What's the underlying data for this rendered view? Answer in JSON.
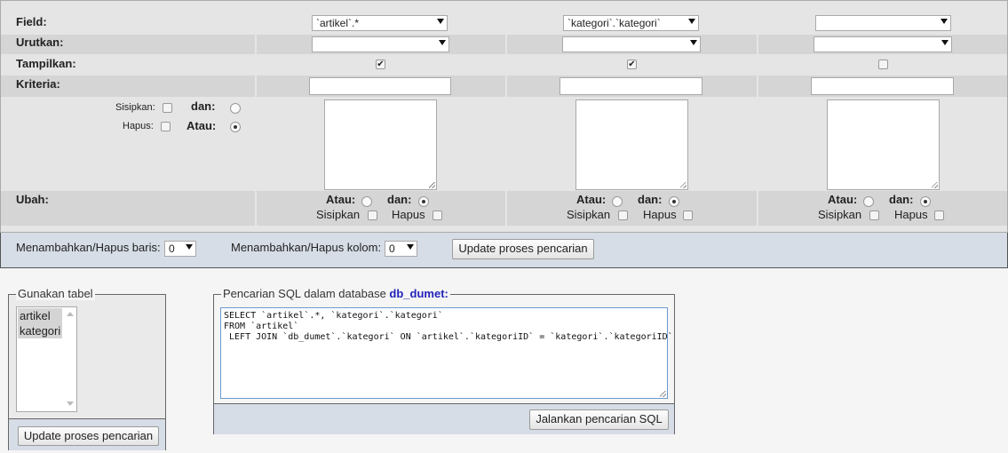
{
  "grid": {
    "labels": {
      "field": "Field:",
      "sort": "Urutkan:",
      "show": "Tampilkan:",
      "criteria": "Kriteria:",
      "change": "Ubah:"
    },
    "columns": [
      {
        "field": "`artikel`.*",
        "sort": "",
        "show": true
      },
      {
        "field": "`kategori`.`kategori`",
        "sort": "",
        "show": true
      },
      {
        "field": "",
        "sort": "",
        "show": false
      }
    ],
    "row_ops": {
      "insert_label": "Sisipkan:",
      "delete_label": "Hapus:",
      "and_label": "dan:",
      "or_label": "Atau:"
    },
    "col_ops": {
      "or_label": "Atau:",
      "and_label": "dan:",
      "insert_label": "Sisipkan",
      "delete_label": "Hapus"
    }
  },
  "bar": {
    "rows_label": "Menambahkan/Hapus baris:",
    "rows_value": "0",
    "cols_label": "Menambahkan/Hapus kolom:",
    "cols_value": "0",
    "update_button": "Update proses pencarian"
  },
  "tables_panel": {
    "legend": "Gunakan tabel",
    "items": [
      "artikel",
      "kategori"
    ],
    "update_button": "Update proses pencarian"
  },
  "sql_panel": {
    "legend_prefix": "Pencarian SQL dalam database ",
    "db_name": "db_dumet",
    "legend_suffix": ":",
    "lines": [
      "SELECT `artikel`.*, `kategori`.`kategori`",
      "FROM `artikel`",
      " LEFT JOIN `db_dumet`.`kategori` ON `artikel`.`kategoriID` = `kategori`.`kategoriID`"
    ],
    "run_button": "Jalankan pencarian SQL"
  }
}
